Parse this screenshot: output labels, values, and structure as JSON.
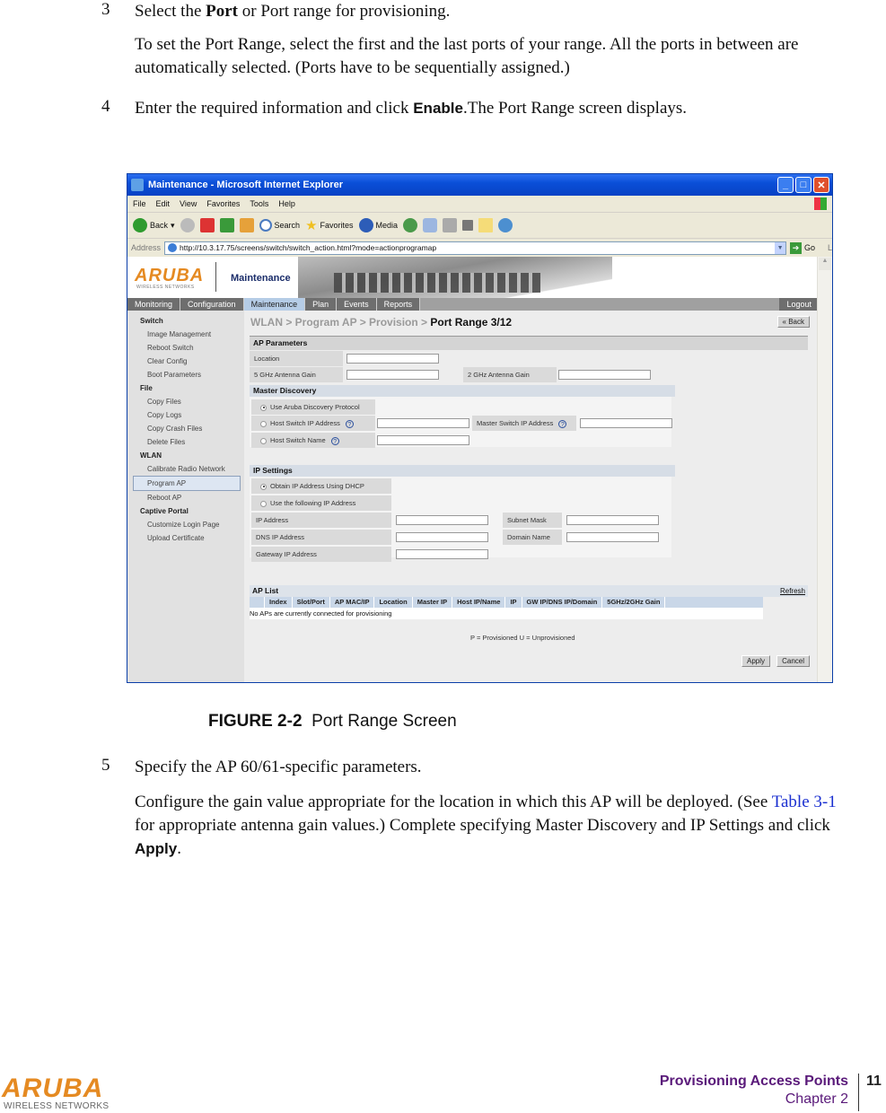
{
  "steps": [
    {
      "number": "3",
      "pre": "Select the ",
      "bold": "Port",
      "post": " or Port range for provisioning.",
      "detail": "To set the Port Range, select the first and the last ports of your range. All the ports in between are automatically selected. (Ports have to be sequentially assigned.)"
    },
    {
      "number": "4",
      "pre": "Enter the required information and click ",
      "bold": "Enable",
      "post": ".The Port Range screen displays."
    },
    {
      "number": "5",
      "text": "Specify the AP 60/61-specific parameters.",
      "detail_pre": "Configure the gain value appropriate for the location in which this AP will be deployed. (See ",
      "detail_link": "Table 3-1",
      "detail_mid": "  for appropriate antenna gain values.) Complete specifying Master Discovery and IP Settings and click ",
      "detail_bold": "Apply",
      "detail_post": "."
    }
  ],
  "figure": {
    "label": "FIGURE 2-2",
    "title": "Port Range Screen"
  },
  "browser": {
    "title": "Maintenance - Microsoft Internet Explorer",
    "menu": [
      "File",
      "Edit",
      "View",
      "Favorites",
      "Tools",
      "Help"
    ],
    "toolbar": {
      "back": "Back",
      "search": "Search",
      "favorites": "Favorites",
      "media": "Media"
    },
    "address_label": "Address",
    "url": "http://10.3.17.75/screens/switch/switch_action.html?mode=actionprogramap",
    "go": "Go",
    "links": "Links"
  },
  "app": {
    "logo": "ARUBA",
    "logo_sub": "WIRELESS NETWORKS",
    "page_title": "Maintenance",
    "tabs": [
      "Monitoring",
      "Configuration",
      "Maintenance",
      "Plan",
      "Events",
      "Reports"
    ],
    "active_tab": "Maintenance",
    "logout": "Logout",
    "sidebar": [
      {
        "type": "group",
        "label": "Switch"
      },
      {
        "type": "item",
        "label": "Image Management"
      },
      {
        "type": "item",
        "label": "Reboot Switch"
      },
      {
        "type": "item",
        "label": "Clear Config"
      },
      {
        "type": "item",
        "label": "Boot Parameters"
      },
      {
        "type": "group",
        "label": "File"
      },
      {
        "type": "item",
        "label": "Copy Files"
      },
      {
        "type": "item",
        "label": "Copy Logs"
      },
      {
        "type": "item",
        "label": "Copy Crash Files"
      },
      {
        "type": "item",
        "label": "Delete Files"
      },
      {
        "type": "group",
        "label": "WLAN"
      },
      {
        "type": "item",
        "label": "Calibrate Radio Network"
      },
      {
        "type": "item",
        "label": "Program AP",
        "selected": true
      },
      {
        "type": "item",
        "label": "Reboot AP"
      },
      {
        "type": "group",
        "label": "Captive Portal"
      },
      {
        "type": "item",
        "label": "Customize Login Page"
      },
      {
        "type": "item",
        "label": "Upload Certificate"
      }
    ],
    "breadcrumb": {
      "path": "WLAN > Program AP > Provision > ",
      "current": "Port Range 3/12"
    },
    "back_button": "« Back",
    "ap_parameters": {
      "heading": "AP Parameters",
      "location": {
        "label": "Location",
        "value": ""
      },
      "gain5": {
        "label": "5 GHz Antenna Gain",
        "value": ""
      },
      "gain2": {
        "label": "2 GHz Antenna Gain",
        "value": ""
      }
    },
    "master_discovery": {
      "heading": "Master Discovery",
      "option_adp": "Use Aruba Discovery Protocol",
      "option_host_ip": "Host Switch IP Address",
      "option_host_name": "Host Switch Name",
      "master_ip_label": "Master Switch IP Address",
      "selected": "Use Aruba Discovery Protocol",
      "help": "?"
    },
    "ip_settings": {
      "heading": "IP Settings",
      "option_dhcp": "Obtain IP Address Using DHCP",
      "option_static": "Use the following IP Address",
      "selected": "Obtain IP Address Using DHCP",
      "ip_address": "IP Address",
      "subnet_mask": "Subnet Mask",
      "dns_ip": "DNS IP Address",
      "domain_name": "Domain Name",
      "gateway_ip": "Gateway IP Address"
    },
    "ap_list": {
      "heading": "AP List",
      "refresh": "Refresh",
      "columns": [
        "Index",
        "Slot/Port",
        "AP MAC/IP",
        "Location",
        "Master IP",
        "Host IP/Name",
        "IP",
        "GW IP/DNS IP/Domain",
        "5GHz/2GHz Gain"
      ],
      "empty_message": "No APs are currently connected for provisioning",
      "legend": "P = Provisioned U = Unprovisioned"
    },
    "apply": "Apply",
    "cancel": "Cancel"
  },
  "footer": {
    "logo": "ARUBA",
    "logo_sub": "WIRELESS NETWORKS",
    "section": "Provisioning Access Points",
    "chapter": "Chapter 2",
    "page": "11"
  }
}
